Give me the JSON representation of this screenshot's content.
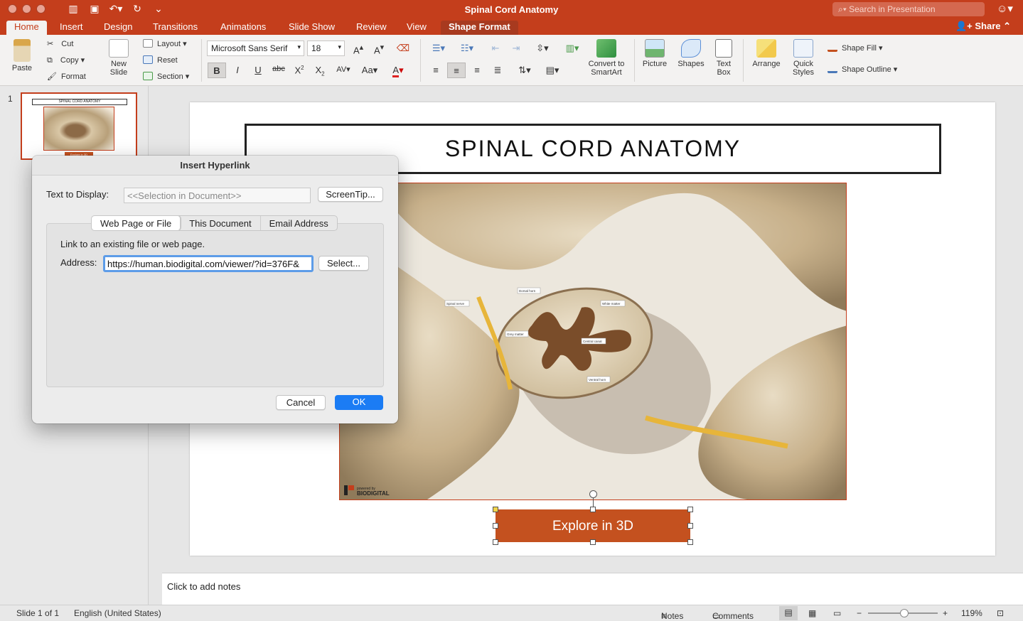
{
  "window": {
    "title": "Spinal Cord Anatomy",
    "search_placeholder": "Search in Presentation"
  },
  "tabs": [
    "Home",
    "Insert",
    "Design",
    "Transitions",
    "Animations",
    "Slide Show",
    "Review",
    "View",
    "Shape Format"
  ],
  "active_tab": "Home",
  "share_label": "Share",
  "ribbon": {
    "paste": "Paste",
    "cut": "Cut",
    "copy": "Copy",
    "format": "Format",
    "new_slide": "New Slide",
    "layout": "Layout",
    "reset": "Reset",
    "section": "Section",
    "font_name": "Microsoft Sans Serif",
    "font_size": "18",
    "convert_smartart": "Convert to SmartArt",
    "picture": "Picture",
    "shapes": "Shapes",
    "text_box": "Text Box",
    "arrange": "Arrange",
    "quick_styles": "Quick Styles",
    "shape_fill": "Shape Fill",
    "shape_outline": "Shape Outline"
  },
  "thumbnail": {
    "number": "1",
    "title": "SPINAL CORD ANATOMY",
    "button": "Explore in 3D"
  },
  "slide": {
    "title": "SPINAL CORD ANATOMY",
    "button_label": "Explore in 3D",
    "image_labels": {
      "dorsal_horn": "Dorsal horn",
      "white_matter": "White matter",
      "spinal_nerve": "Spinal nerve",
      "grey_matter": "Grey matter",
      "central_canal": "Central canal",
      "ventral_horn": "Ventral horn",
      "powered_by": "powered by",
      "brand": "BIODIGITAL"
    }
  },
  "notes_placeholder": "Click to add notes",
  "status": {
    "slide_info": "Slide 1 of 1",
    "language": "English (United States)",
    "notes": "Notes",
    "comments": "Comments",
    "zoom": "119%"
  },
  "dialog": {
    "title": "Insert Hyperlink",
    "text_to_display_label": "Text to Display:",
    "text_to_display_value": "<<Selection in Document>>",
    "screentip_button": "ScreenTip...",
    "tabs": [
      "Web Page or File",
      "This Document",
      "Email Address"
    ],
    "selected_tab": "Web Page or File",
    "instruction": "Link to an existing file or web page.",
    "address_label": "Address:",
    "address_value": "https://human.biodigital.com/viewer/?id=376F&",
    "select_button": "Select...",
    "cancel_button": "Cancel",
    "ok_button": "OK"
  },
  "colors": {
    "accent": "#c43e1c",
    "button_fill": "#c4511f",
    "ok_blue": "#1b7cf4"
  }
}
